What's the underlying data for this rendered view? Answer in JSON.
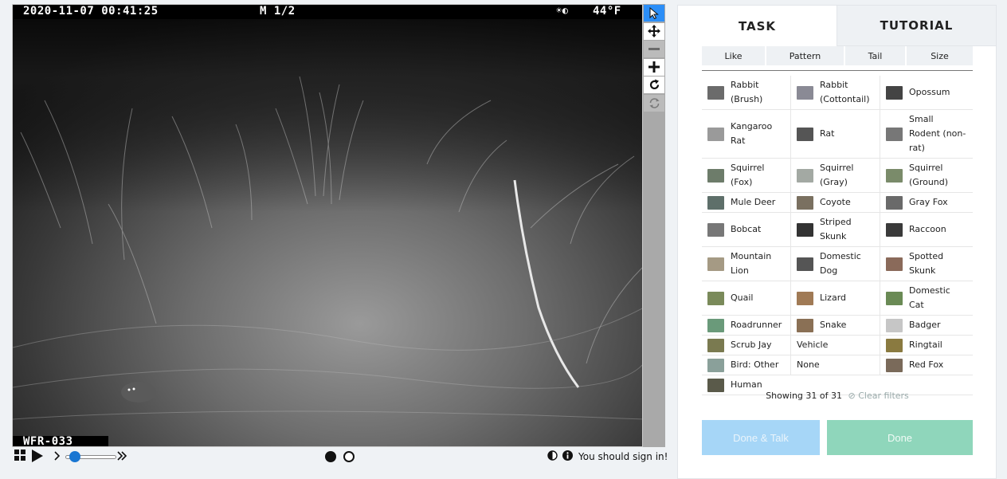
{
  "camera": {
    "timestamp": "2020-11-07  00:41:25",
    "frame": "M 1/2",
    "moon": "☀◐",
    "temperature": "44°F",
    "site_id": "WFR-033"
  },
  "tools": [
    {
      "name": "pointer-tool",
      "icon": "cursor-icon",
      "state": "active"
    },
    {
      "name": "pan-tool",
      "icon": "move-icon",
      "state": "normal"
    },
    {
      "name": "zoom-out-tool",
      "icon": "minus-icon",
      "state": "disabled"
    },
    {
      "name": "zoom-in-tool",
      "icon": "plus-icon",
      "state": "normal"
    },
    {
      "name": "rotate-tool",
      "icon": "rotate-icon",
      "state": "normal"
    },
    {
      "name": "reset-tool",
      "icon": "refresh-icon",
      "state": "disabled"
    }
  ],
  "controls": {
    "signin": "You should sign in!",
    "playback_position": 0.1
  },
  "tabs": [
    {
      "label": "TASK",
      "active": true
    },
    {
      "label": "TUTORIAL",
      "active": false
    }
  ],
  "filters": [
    "Like",
    "Pattern",
    "Tail",
    "Size"
  ],
  "choices": [
    [
      {
        "label": "Rabbit (Brush)",
        "color": "#6b6b6b"
      },
      {
        "label": "Rabbit (Cottontail)",
        "color": "#8a8a95"
      },
      {
        "label": "Opossum",
        "color": "#444"
      }
    ],
    [
      {
        "label": "Kangaroo Rat",
        "color": "#9a9a9a"
      },
      {
        "label": "Rat",
        "color": "#555"
      },
      {
        "label": "Small Rodent (non-rat)",
        "color": "#777"
      }
    ],
    [
      {
        "label": "Squirrel (Fox)",
        "color": "#6d7c6a"
      },
      {
        "label": "Squirrel (Gray)",
        "color": "#a3a9a3"
      },
      {
        "label": "Squirrel (Ground)",
        "color": "#7a8b6a"
      }
    ],
    [
      {
        "label": "Mule Deer",
        "color": "#5e6f6a"
      },
      {
        "label": "Coyote",
        "color": "#7a7060"
      },
      {
        "label": "Gray Fox",
        "color": "#6a6a6a"
      }
    ],
    [
      {
        "label": "Bobcat",
        "color": "#777"
      },
      {
        "label": "Striped Skunk",
        "color": "#333"
      },
      {
        "label": "Raccoon",
        "color": "#3a3a3a"
      }
    ],
    [
      {
        "label": "Mountain Lion",
        "color": "#a59a84"
      },
      {
        "label": "Domestic Dog",
        "color": "#555"
      },
      {
        "label": "Spotted Skunk",
        "color": "#8a6a5a"
      }
    ],
    [
      {
        "label": "Quail",
        "color": "#7a8a5a"
      },
      {
        "label": "Lizard",
        "color": "#a07a55"
      },
      {
        "label": "Domestic Cat",
        "color": "#6a8a55"
      }
    ],
    [
      {
        "label": "Roadrunner",
        "color": "#6a9a7a"
      },
      {
        "label": "Snake",
        "color": "#8a7055"
      },
      {
        "label": "Badger",
        "color": "#c6c6c6"
      }
    ],
    [
      {
        "label": "Scrub Jay",
        "color": "#7a7a50"
      },
      {
        "label": "Vehicle",
        "color": ""
      },
      {
        "label": "Ringtail",
        "color": "#8a7a40"
      }
    ],
    [
      {
        "label": "Bird: Other",
        "color": "#8aa09a"
      },
      {
        "label": "None",
        "color": ""
      },
      {
        "label": "Red Fox",
        "color": "#7a6a5a"
      }
    ],
    [
      {
        "label": "Human",
        "color": "#5a5a4a"
      }
    ]
  ],
  "showing": "Showing 31 of 31",
  "clear_filters": "Clear filters",
  "buttons": {
    "done_talk": "Done & Talk",
    "done": "Done"
  }
}
